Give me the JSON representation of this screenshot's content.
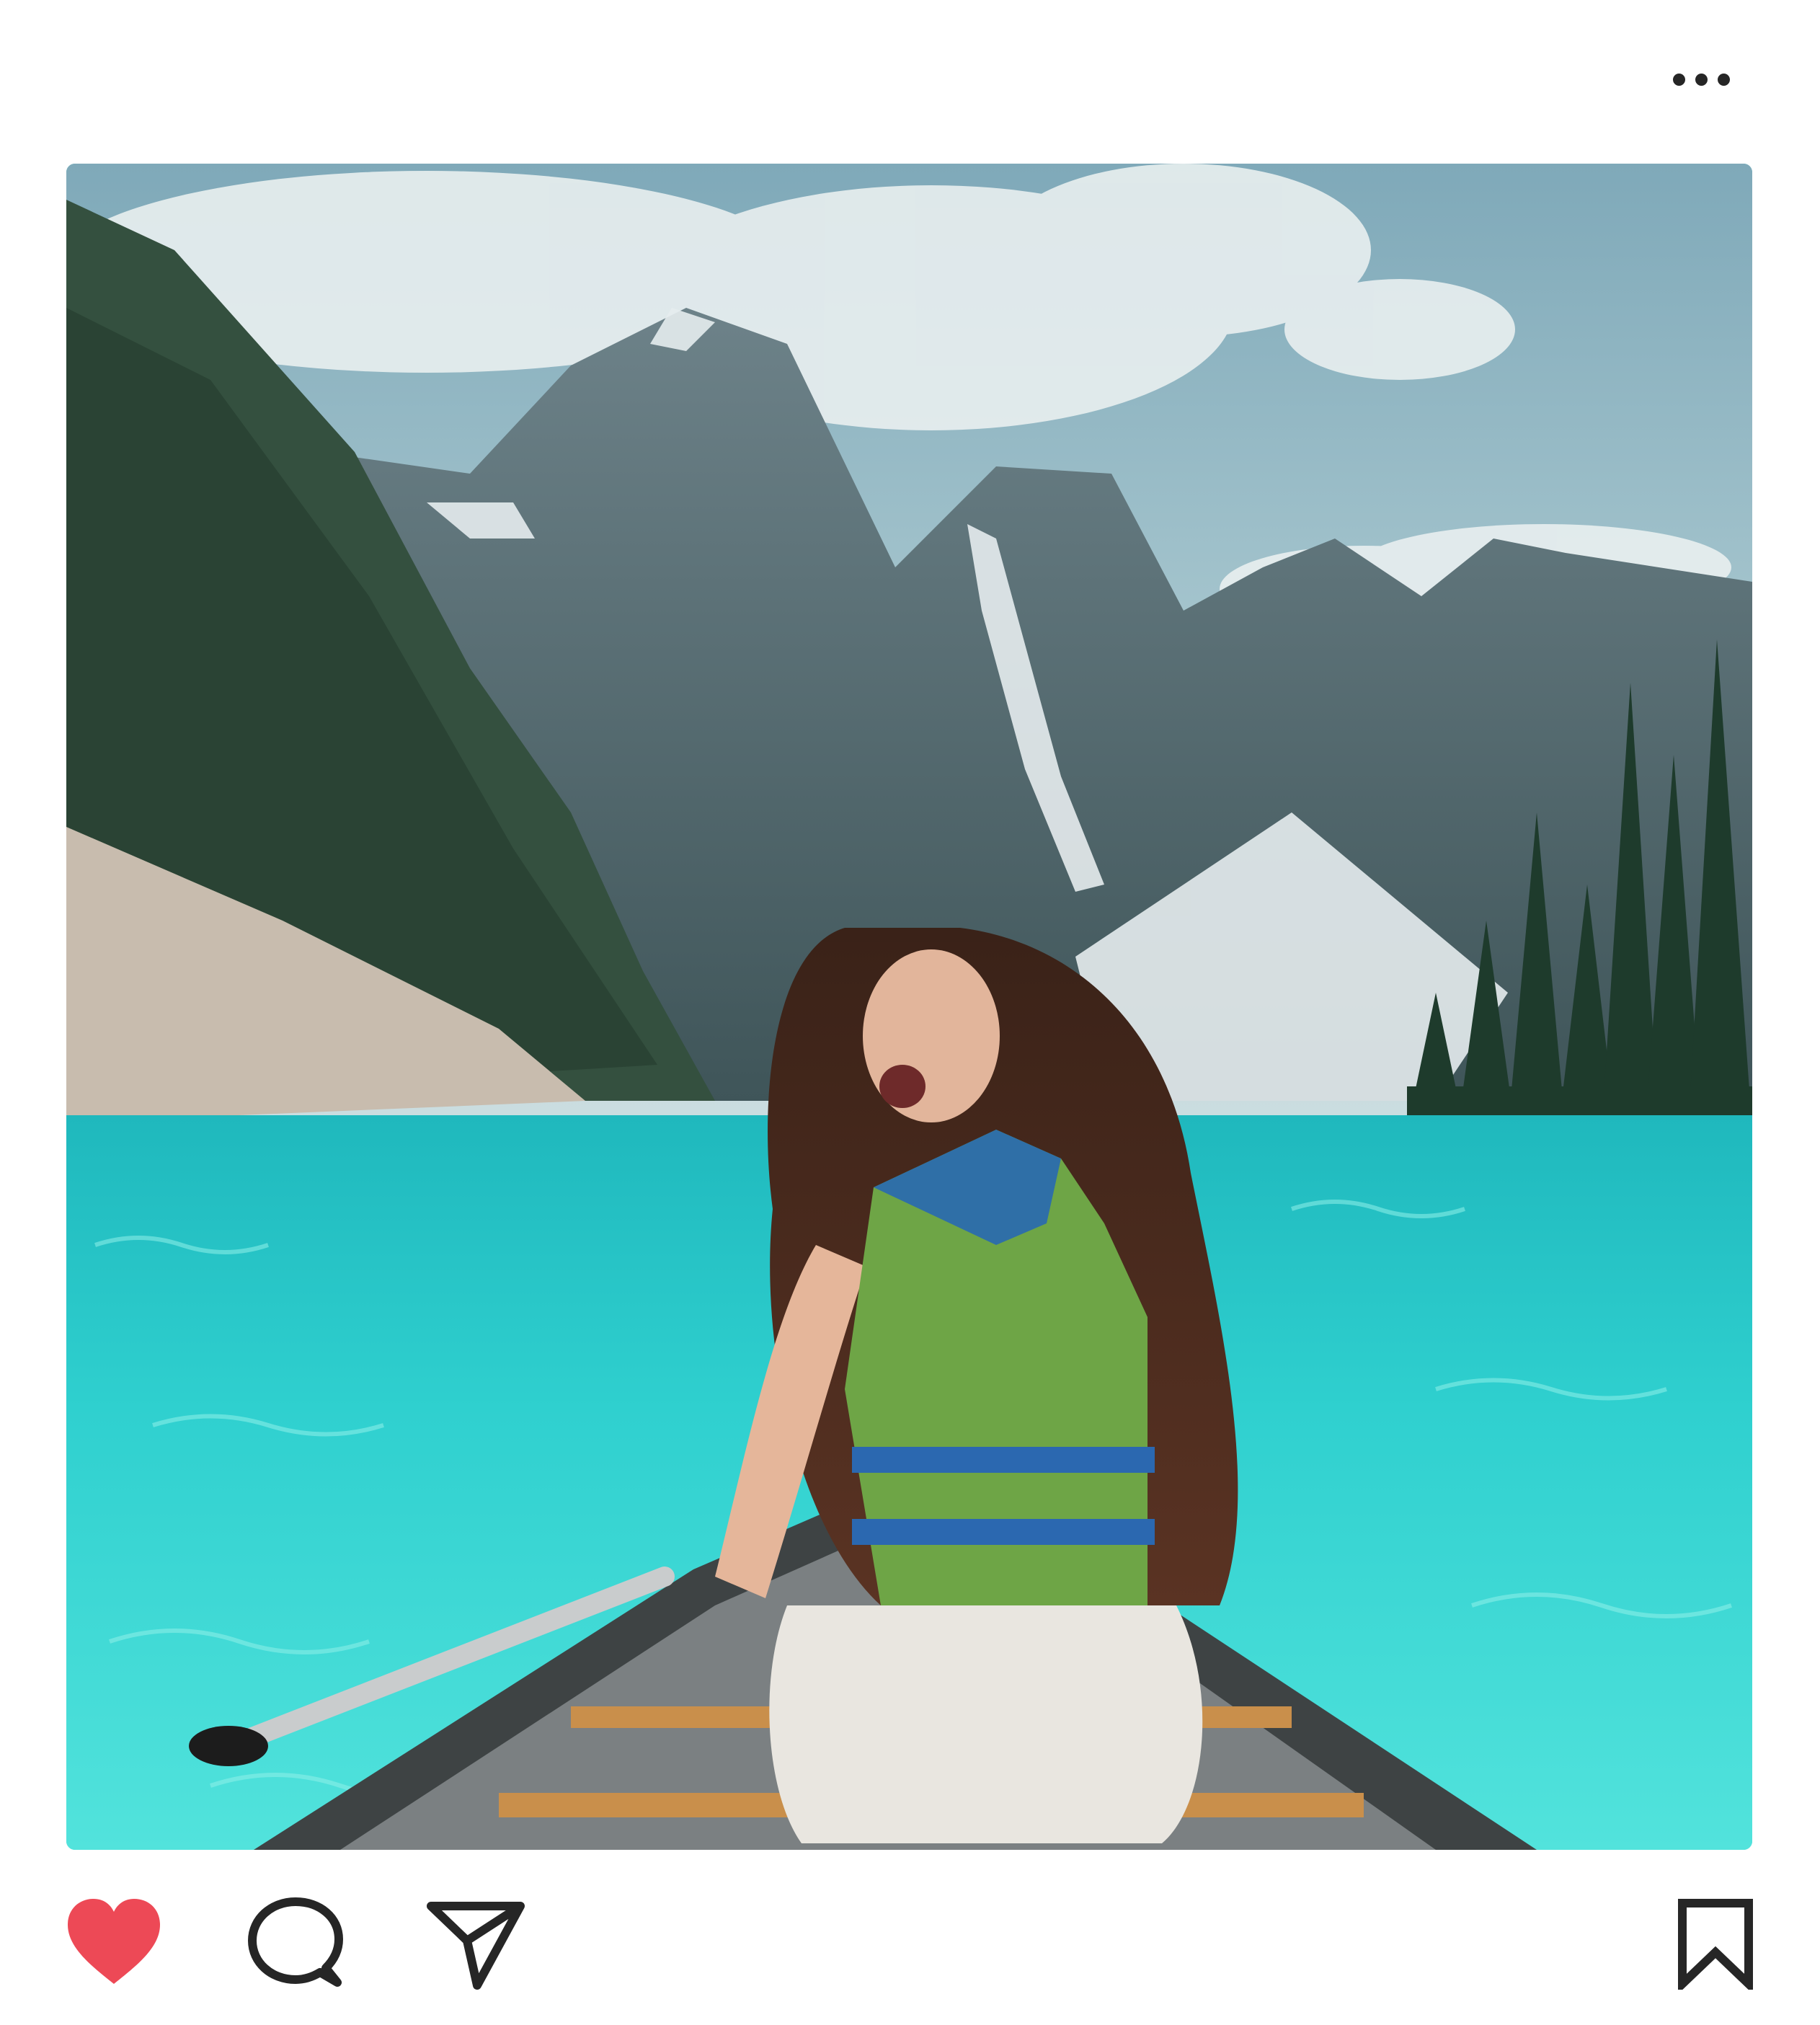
{
  "post": {
    "menu": {
      "icon": "more-horizontal-icon"
    },
    "image": {
      "subject": ""
    },
    "actions": {
      "like": {
        "icon": "heart-filled-icon",
        "active": true,
        "color": "#ed4956"
      },
      "comment": {
        "icon": "speech-bubble-icon"
      },
      "share": {
        "icon": "paper-plane-icon"
      },
      "save": {
        "icon": "bookmark-icon"
      }
    }
  },
  "colors": {
    "background": "#ffffff",
    "icon_stroke": "#262626",
    "like_active": "#ed4956"
  }
}
